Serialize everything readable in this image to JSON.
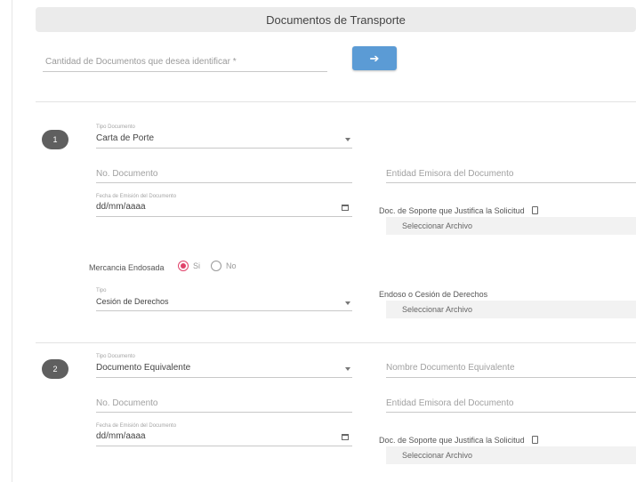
{
  "header": {
    "title": "Documentos de Transporte"
  },
  "count": {
    "label": "Cantidad de Documentos que desea identificar *",
    "button_glyph": "➔"
  },
  "doc1": {
    "number": "1",
    "tipo_label": "Tipo Documento",
    "tipo_value": "Carta de Porte",
    "no_doc": "No. Documento",
    "entidad": "Entidad Emisora del Documento",
    "fecha_label": "Fecha de Emisión del Documento",
    "fecha_value": "dd/mm/aaaa",
    "soporte_label": "Doc. de Soporte que Justifica la Solicitud",
    "file_label": "Seleccionar Archivo",
    "mercancia_label": "Mercancia Endosada",
    "si_label": "Si",
    "no_label": "No",
    "tipo2_label": "Tipo",
    "tipo2_value": "Cesión de Derechos",
    "endoso_label": "Endoso o Cesión de Derechos",
    "file2_label": "Seleccionar Archivo"
  },
  "doc2": {
    "number": "2",
    "tipo_label": "Tipo Documento",
    "tipo_value": "Documento Equivalente",
    "nombre_equiv": "Nombre Documento Equivalente",
    "no_doc": "No. Documento",
    "entidad": "Entidad Emisora del Documento",
    "fecha_label": "Fecha de Emisión del Documento",
    "fecha_value": "dd/mm/aaaa",
    "soporte_label": "Doc. de Soporte que Justifica la Solicitud",
    "file_label": "Seleccionar Archivo"
  },
  "colors": {
    "accent_button": "#5b9bd5",
    "radio_selected": "#e0426a",
    "badge": "#5f5f5f"
  },
  "icons": {
    "go": "arrow-right-icon",
    "calendar": "calendar-icon",
    "document": "document-icon",
    "caret": "caret-down-icon"
  }
}
